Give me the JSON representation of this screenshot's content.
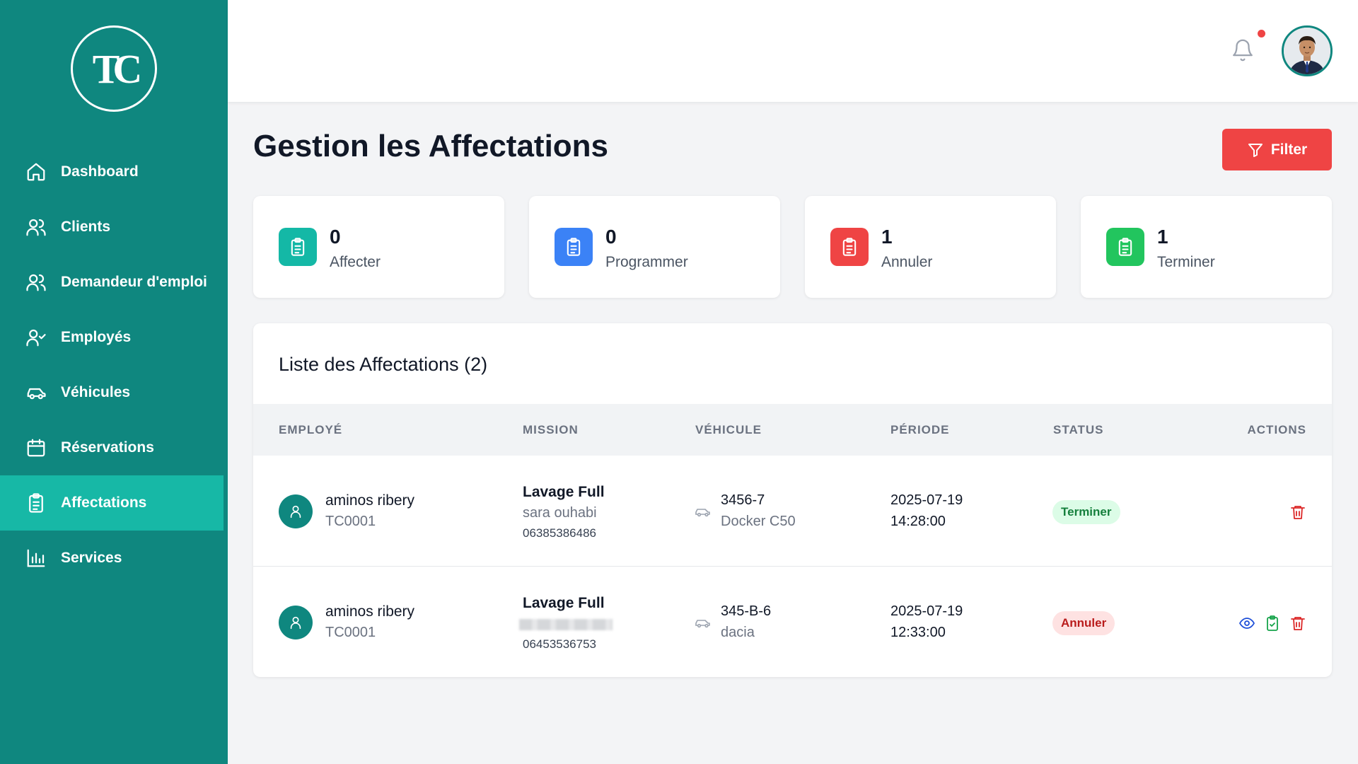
{
  "logo": {
    "text": "TC"
  },
  "sidebar": {
    "items": [
      {
        "label": "Dashboard",
        "icon": "home-icon"
      },
      {
        "label": "Clients",
        "icon": "users-icon"
      },
      {
        "label": "Demandeur d'emploi",
        "icon": "users-icon"
      },
      {
        "label": "Employés",
        "icon": "user-check-icon"
      },
      {
        "label": "Véhicules",
        "icon": "car-icon"
      },
      {
        "label": "Réservations",
        "icon": "calendar-icon"
      },
      {
        "label": "Affectations",
        "icon": "clipboard-icon",
        "active": true
      },
      {
        "label": "Services",
        "icon": "bar-chart-icon"
      }
    ]
  },
  "header": {
    "notification_dot": true
  },
  "page": {
    "title": "Gestion les Affectations",
    "filter_label": "Filter"
  },
  "stats": [
    {
      "value": "0",
      "label": "Affecter",
      "color": "#14b8a6"
    },
    {
      "value": "0",
      "label": "Programmer",
      "color": "#3b82f6"
    },
    {
      "value": "1",
      "label": "Annuler",
      "color": "#ef4444"
    },
    {
      "value": "1",
      "label": "Terminer",
      "color": "#22c55e"
    }
  ],
  "list": {
    "title": "Liste des Affectations (2)",
    "columns": [
      "EMPLOYÉ",
      "MISSION",
      "VÉHICULE",
      "PÉRIODE",
      "STATUS",
      "ACTIONS"
    ],
    "rows": [
      {
        "employee_name": "aminos ribery",
        "employee_code": "TC0001",
        "mission_title": "Lavage Full",
        "mission_client": "sara ouhabi",
        "mission_phone": "06385386486",
        "vehicle_plate": "3456-7",
        "vehicle_model": "Docker C50",
        "date": "2025-07-19",
        "time": "14:28:00",
        "status": "Terminer"
      },
      {
        "employee_name": "aminos ribery",
        "employee_code": "TC0001",
        "mission_title": "Lavage Full",
        "mission_client": "",
        "mission_phone": "06453536753",
        "vehicle_plate": "345-B-6",
        "vehicle_model": "dacia",
        "date": "2025-07-19",
        "time": "12:33:00",
        "status": "Annuler"
      }
    ]
  }
}
